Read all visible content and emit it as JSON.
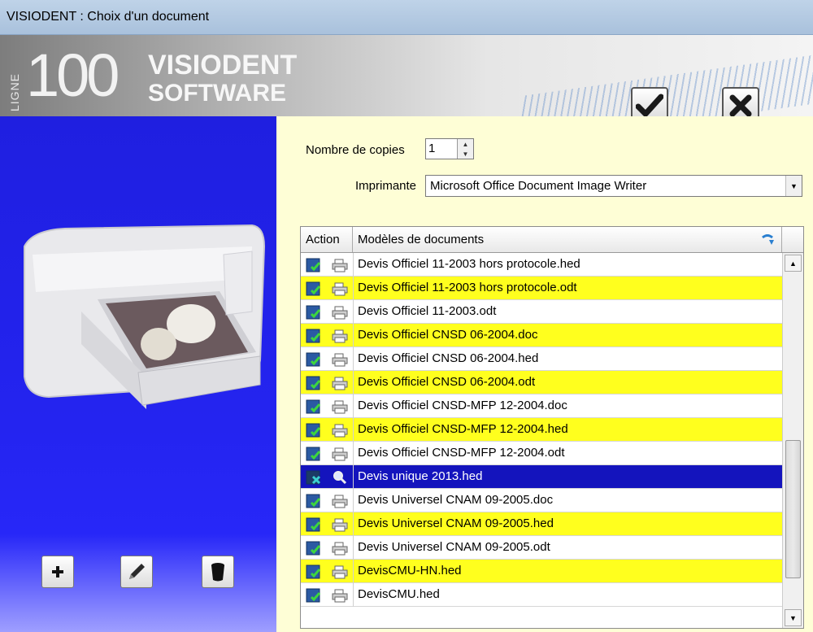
{
  "window": {
    "title": "VISIODENT : Choix d'un document"
  },
  "banner": {
    "logo_ligne": "LIGNE",
    "logo_number": "100",
    "logo_visiodent": "VISIODENT",
    "logo_software": "SOFTWARE"
  },
  "actions": {
    "ok_icon": "checkmark-icon",
    "cancel_icon": "close-x-icon"
  },
  "form": {
    "copies_label": "Nombre de copies",
    "copies_value": "1",
    "printer_label": "Imprimante",
    "printer_value": "Microsoft Office Document Image Writer"
  },
  "grid": {
    "headers": {
      "action": "Action",
      "models": "Modèles de documents"
    },
    "rows": [
      {
        "label": "Devis Officiel 11-2003 hors protocole.hed",
        "style": "white"
      },
      {
        "label": "Devis Officiel 11-2003 hors protocole.odt",
        "style": "yellow"
      },
      {
        "label": "Devis Officiel 11-2003.odt",
        "style": "white"
      },
      {
        "label": "Devis Officiel CNSD 06-2004.doc",
        "style": "yellow"
      },
      {
        "label": "Devis Officiel CNSD 06-2004.hed",
        "style": "white"
      },
      {
        "label": "Devis Officiel CNSD 06-2004.odt",
        "style": "yellow"
      },
      {
        "label": "Devis Officiel CNSD-MFP 12-2004.doc",
        "style": "white"
      },
      {
        "label": "Devis Officiel CNSD-MFP 12-2004.hed",
        "style": "yellow"
      },
      {
        "label": "Devis Officiel CNSD-MFP 12-2004.odt",
        "style": "white"
      },
      {
        "label": "Devis unique 2013.hed",
        "style": "selected"
      },
      {
        "label": "Devis Universel CNAM 09-2005.doc",
        "style": "white"
      },
      {
        "label": "Devis Universel CNAM 09-2005.hed",
        "style": "yellow"
      },
      {
        "label": "Devis Universel CNAM 09-2005.odt",
        "style": "white"
      },
      {
        "label": "DevisCMU-HN.hed",
        "style": "yellow"
      },
      {
        "label": "DevisCMU.hed",
        "style": "white"
      }
    ]
  },
  "left_buttons": {
    "add_icon": "plus-icon",
    "edit_icon": "pencil-icon",
    "delete_icon": "trash-icon"
  },
  "colors": {
    "selected_row": "#1414bd",
    "highlight_row": "#ffff1e",
    "left_panel": "#2424f0",
    "right_panel": "#fefed6"
  }
}
